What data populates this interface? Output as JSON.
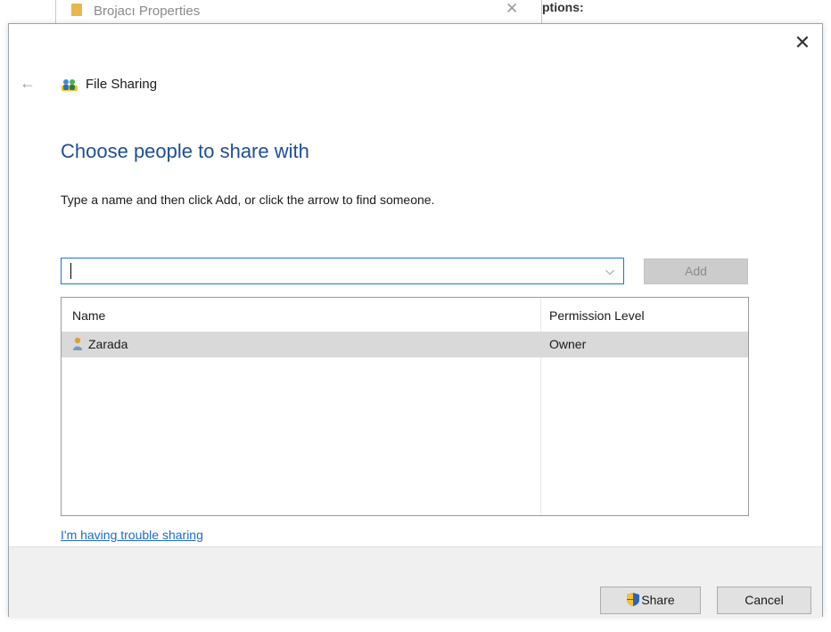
{
  "background": {
    "window_title": "Brojacı Properties",
    "close_glyph": "✕",
    "options_text": "ptions:"
  },
  "dialog": {
    "close_glyph": "✕",
    "back_glyph": "←",
    "header_title": "File Sharing",
    "heading": "Choose people to share with",
    "instruction": "Type a name and then click Add, or click the arrow to find someone.",
    "name_input": {
      "value": "",
      "placeholder": ""
    },
    "dropdown_glyph": "⌵",
    "add_label": "Add",
    "table": {
      "columns": [
        "Name",
        "Permission Level"
      ],
      "rows": [
        {
          "name": "Zarada",
          "permission": "Owner",
          "selected": true
        }
      ]
    },
    "trouble_link": "I'm having trouble sharing",
    "share_label": "Share",
    "cancel_label": "Cancel"
  },
  "icons": {
    "back": "back-arrow-icon",
    "sharing": "people-sharing-icon",
    "user": "user-icon",
    "uac_shield": "uac-shield-icon",
    "close": "close-icon",
    "dropdown": "chevron-down-icon"
  },
  "colors": {
    "heading": "#1f4e96",
    "link": "#1c6cc7",
    "focus_border": "#1c76d2",
    "selected_row": "#d9d9d9",
    "disabled_button": "#cccccc",
    "footer": "#f0f0f0"
  }
}
